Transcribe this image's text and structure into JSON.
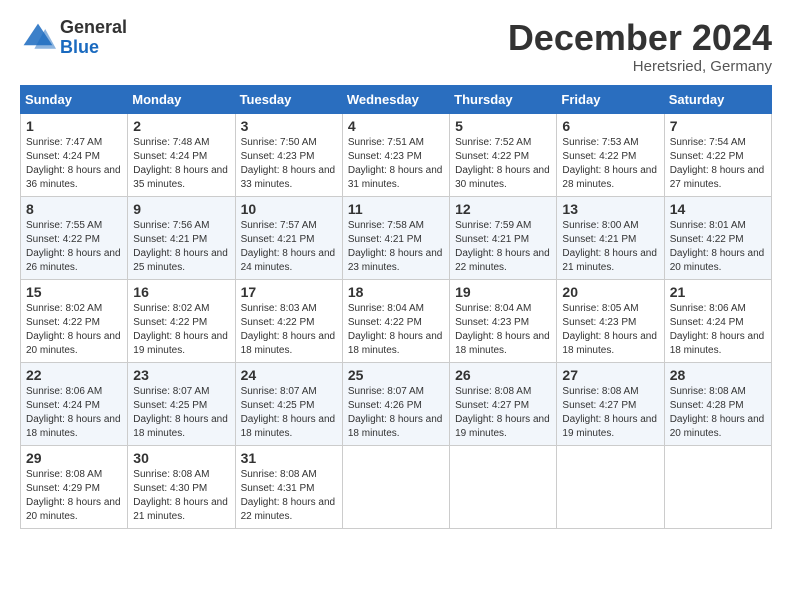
{
  "header": {
    "logo_general": "General",
    "logo_blue": "Blue",
    "month_title": "December 2024",
    "location": "Heretsried, Germany"
  },
  "weekdays": [
    "Sunday",
    "Monday",
    "Tuesday",
    "Wednesday",
    "Thursday",
    "Friday",
    "Saturday"
  ],
  "weeks": [
    [
      {
        "day": "1",
        "sunrise": "7:47 AM",
        "sunset": "4:24 PM",
        "daylight": "8 hours and 36 minutes."
      },
      {
        "day": "2",
        "sunrise": "7:48 AM",
        "sunset": "4:24 PM",
        "daylight": "8 hours and 35 minutes."
      },
      {
        "day": "3",
        "sunrise": "7:50 AM",
        "sunset": "4:23 PM",
        "daylight": "8 hours and 33 minutes."
      },
      {
        "day": "4",
        "sunrise": "7:51 AM",
        "sunset": "4:23 PM",
        "daylight": "8 hours and 31 minutes."
      },
      {
        "day": "5",
        "sunrise": "7:52 AM",
        "sunset": "4:22 PM",
        "daylight": "8 hours and 30 minutes."
      },
      {
        "day": "6",
        "sunrise": "7:53 AM",
        "sunset": "4:22 PM",
        "daylight": "8 hours and 28 minutes."
      },
      {
        "day": "7",
        "sunrise": "7:54 AM",
        "sunset": "4:22 PM",
        "daylight": "8 hours and 27 minutes."
      }
    ],
    [
      {
        "day": "8",
        "sunrise": "7:55 AM",
        "sunset": "4:22 PM",
        "daylight": "8 hours and 26 minutes."
      },
      {
        "day": "9",
        "sunrise": "7:56 AM",
        "sunset": "4:21 PM",
        "daylight": "8 hours and 25 minutes."
      },
      {
        "day": "10",
        "sunrise": "7:57 AM",
        "sunset": "4:21 PM",
        "daylight": "8 hours and 24 minutes."
      },
      {
        "day": "11",
        "sunrise": "7:58 AM",
        "sunset": "4:21 PM",
        "daylight": "8 hours and 23 minutes."
      },
      {
        "day": "12",
        "sunrise": "7:59 AM",
        "sunset": "4:21 PM",
        "daylight": "8 hours and 22 minutes."
      },
      {
        "day": "13",
        "sunrise": "8:00 AM",
        "sunset": "4:21 PM",
        "daylight": "8 hours and 21 minutes."
      },
      {
        "day": "14",
        "sunrise": "8:01 AM",
        "sunset": "4:22 PM",
        "daylight": "8 hours and 20 minutes."
      }
    ],
    [
      {
        "day": "15",
        "sunrise": "8:02 AM",
        "sunset": "4:22 PM",
        "daylight": "8 hours and 20 minutes."
      },
      {
        "day": "16",
        "sunrise": "8:02 AM",
        "sunset": "4:22 PM",
        "daylight": "8 hours and 19 minutes."
      },
      {
        "day": "17",
        "sunrise": "8:03 AM",
        "sunset": "4:22 PM",
        "daylight": "8 hours and 18 minutes."
      },
      {
        "day": "18",
        "sunrise": "8:04 AM",
        "sunset": "4:22 PM",
        "daylight": "8 hours and 18 minutes."
      },
      {
        "day": "19",
        "sunrise": "8:04 AM",
        "sunset": "4:23 PM",
        "daylight": "8 hours and 18 minutes."
      },
      {
        "day": "20",
        "sunrise": "8:05 AM",
        "sunset": "4:23 PM",
        "daylight": "8 hours and 18 minutes."
      },
      {
        "day": "21",
        "sunrise": "8:06 AM",
        "sunset": "4:24 PM",
        "daylight": "8 hours and 18 minutes."
      }
    ],
    [
      {
        "day": "22",
        "sunrise": "8:06 AM",
        "sunset": "4:24 PM",
        "daylight": "8 hours and 18 minutes."
      },
      {
        "day": "23",
        "sunrise": "8:07 AM",
        "sunset": "4:25 PM",
        "daylight": "8 hours and 18 minutes."
      },
      {
        "day": "24",
        "sunrise": "8:07 AM",
        "sunset": "4:25 PM",
        "daylight": "8 hours and 18 minutes."
      },
      {
        "day": "25",
        "sunrise": "8:07 AM",
        "sunset": "4:26 PM",
        "daylight": "8 hours and 18 minutes."
      },
      {
        "day": "26",
        "sunrise": "8:08 AM",
        "sunset": "4:27 PM",
        "daylight": "8 hours and 19 minutes."
      },
      {
        "day": "27",
        "sunrise": "8:08 AM",
        "sunset": "4:27 PM",
        "daylight": "8 hours and 19 minutes."
      },
      {
        "day": "28",
        "sunrise": "8:08 AM",
        "sunset": "4:28 PM",
        "daylight": "8 hours and 20 minutes."
      }
    ],
    [
      {
        "day": "29",
        "sunrise": "8:08 AM",
        "sunset": "4:29 PM",
        "daylight": "8 hours and 20 minutes."
      },
      {
        "day": "30",
        "sunrise": "8:08 AM",
        "sunset": "4:30 PM",
        "daylight": "8 hours and 21 minutes."
      },
      {
        "day": "31",
        "sunrise": "8:08 AM",
        "sunset": "4:31 PM",
        "daylight": "8 hours and 22 minutes."
      },
      null,
      null,
      null,
      null
    ]
  ]
}
